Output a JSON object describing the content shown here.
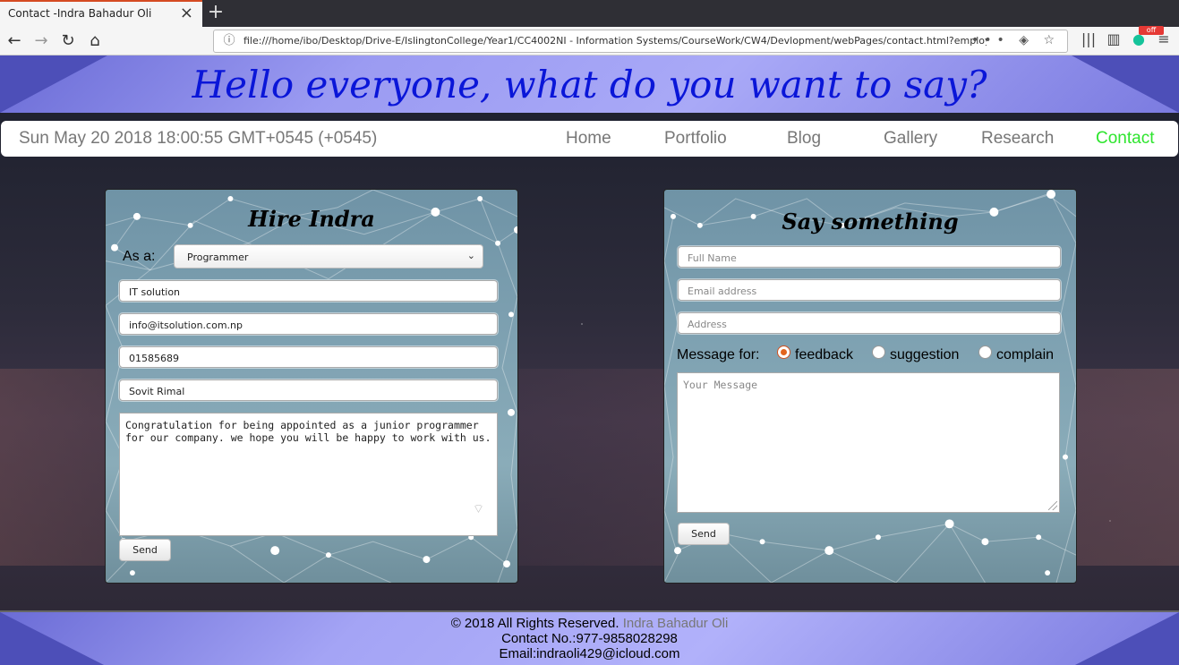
{
  "browser": {
    "tab_title": "Contact -Indra Bahadur Oli",
    "url": "file:///home/ibo/Desktop/Drive-E/IslingtonCollege/Year1/CC4002NI - Information Systems/CourseWork/CW4/Devlopment/webPages/contact.html?employee=programm",
    "extension_badge": "off"
  },
  "header": {
    "title": "Hello everyone, what do you want to say?"
  },
  "menubar": {
    "date": "Sun May 20 2018 18:00:55 GMT+0545 (+0545)",
    "items": [
      {
        "label": "Home"
      },
      {
        "label": "Portfolio"
      },
      {
        "label": "Blog"
      },
      {
        "label": "Gallery"
      },
      {
        "label": "Research"
      },
      {
        "label": "Contact"
      }
    ],
    "active_color": "#2ee52e"
  },
  "hire_form": {
    "title": "Hire Indra",
    "as_label": "As a:",
    "as_value": "Programmer",
    "company": "IT solution",
    "email": "info@itsolution.com.np",
    "phone": "01585689",
    "name": "Sovit Rimal",
    "message": "Congratulation for being appointed as a junior programmer for our company. we hope you will be happy to work with us.",
    "send_label": "Send"
  },
  "say_form": {
    "title": "Say something",
    "full_name_placeholder": "Full Name",
    "email_placeholder": "Email address",
    "address_placeholder": "Address",
    "message_for_label": "Message for:",
    "options": [
      {
        "label": "feedback",
        "checked": true
      },
      {
        "label": "suggestion",
        "checked": false
      },
      {
        "label": "complain",
        "checked": false
      }
    ],
    "message_placeholder": "Your Message",
    "send_label": "Send"
  },
  "footer": {
    "copyright": "© 2018 All Rights Reserved.",
    "author": "Indra Bahadur Oli",
    "contact": "Contact No.:977-9858028298",
    "email": "Email:indraoli429@icloud.com"
  }
}
